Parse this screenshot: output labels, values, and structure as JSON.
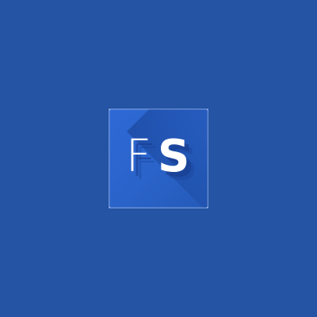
{
  "app_icon": {
    "text_f": "F",
    "text_s": "S"
  },
  "colors": {
    "background": "#2454a3",
    "tile": "#2a63c9",
    "text": "#ffffff"
  }
}
